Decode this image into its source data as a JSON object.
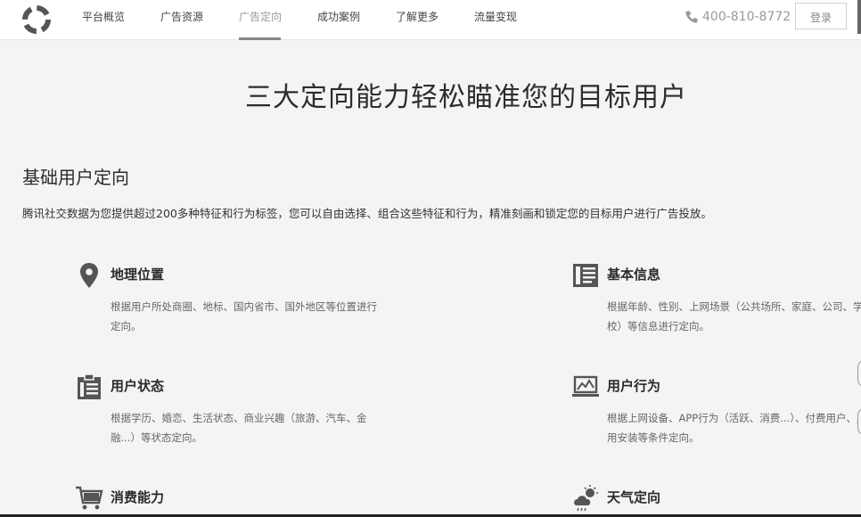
{
  "nav": {
    "items": [
      {
        "label": "平台概览",
        "active": false
      },
      {
        "label": "广告资源",
        "active": false
      },
      {
        "label": "广告定向",
        "active": true
      },
      {
        "label": "成功案例",
        "active": false
      },
      {
        "label": "了解更多",
        "active": false
      },
      {
        "label": "流量变现",
        "active": false
      }
    ],
    "phone": "400-810-8772",
    "login_label": "登录"
  },
  "hero": {
    "title": "三大定向能力轻松瞄准您的目标用户"
  },
  "section": {
    "title": "基础用户定向",
    "desc": "腾讯社交数据为您提供超过200多种特征和行为标签，您可以自由选择、组合这些特征和行为，精准刻画和锁定您的目标用户进行广告投放。"
  },
  "features": [
    {
      "icon": "location-pin-icon",
      "title": "地理位置",
      "desc": "根据用户所处商圈、地标、国内省市、国外地区等位置进行定向。"
    },
    {
      "icon": "profile-card-icon",
      "title": "基本信息",
      "desc": "根据年龄、性别、上网场景（公共场所、家庭、公司、学校）等信息进行定向。"
    },
    {
      "icon": "clipboard-icon",
      "title": "用户状态",
      "desc": "根据学历、婚恋、生活状态、商业兴趣（旅游、汽车、金融...）等状态定向。"
    },
    {
      "icon": "laptop-chart-icon",
      "title": "用户行为",
      "desc": "根据上网设备、APP行为（活跃、消费...）、付费用户、应用安装等条件定向。"
    },
    {
      "icon": "shopping-cart-icon",
      "title": "消费能力",
      "desc": ""
    },
    {
      "icon": "weather-icon",
      "title": "天气定向",
      "desc": ""
    }
  ],
  "colors": {
    "background": "#f4f4f4",
    "header_bg": "#ffffff",
    "icon": "#555555",
    "text_dark": "#2a2a2a",
    "text_muted": "#666666"
  }
}
